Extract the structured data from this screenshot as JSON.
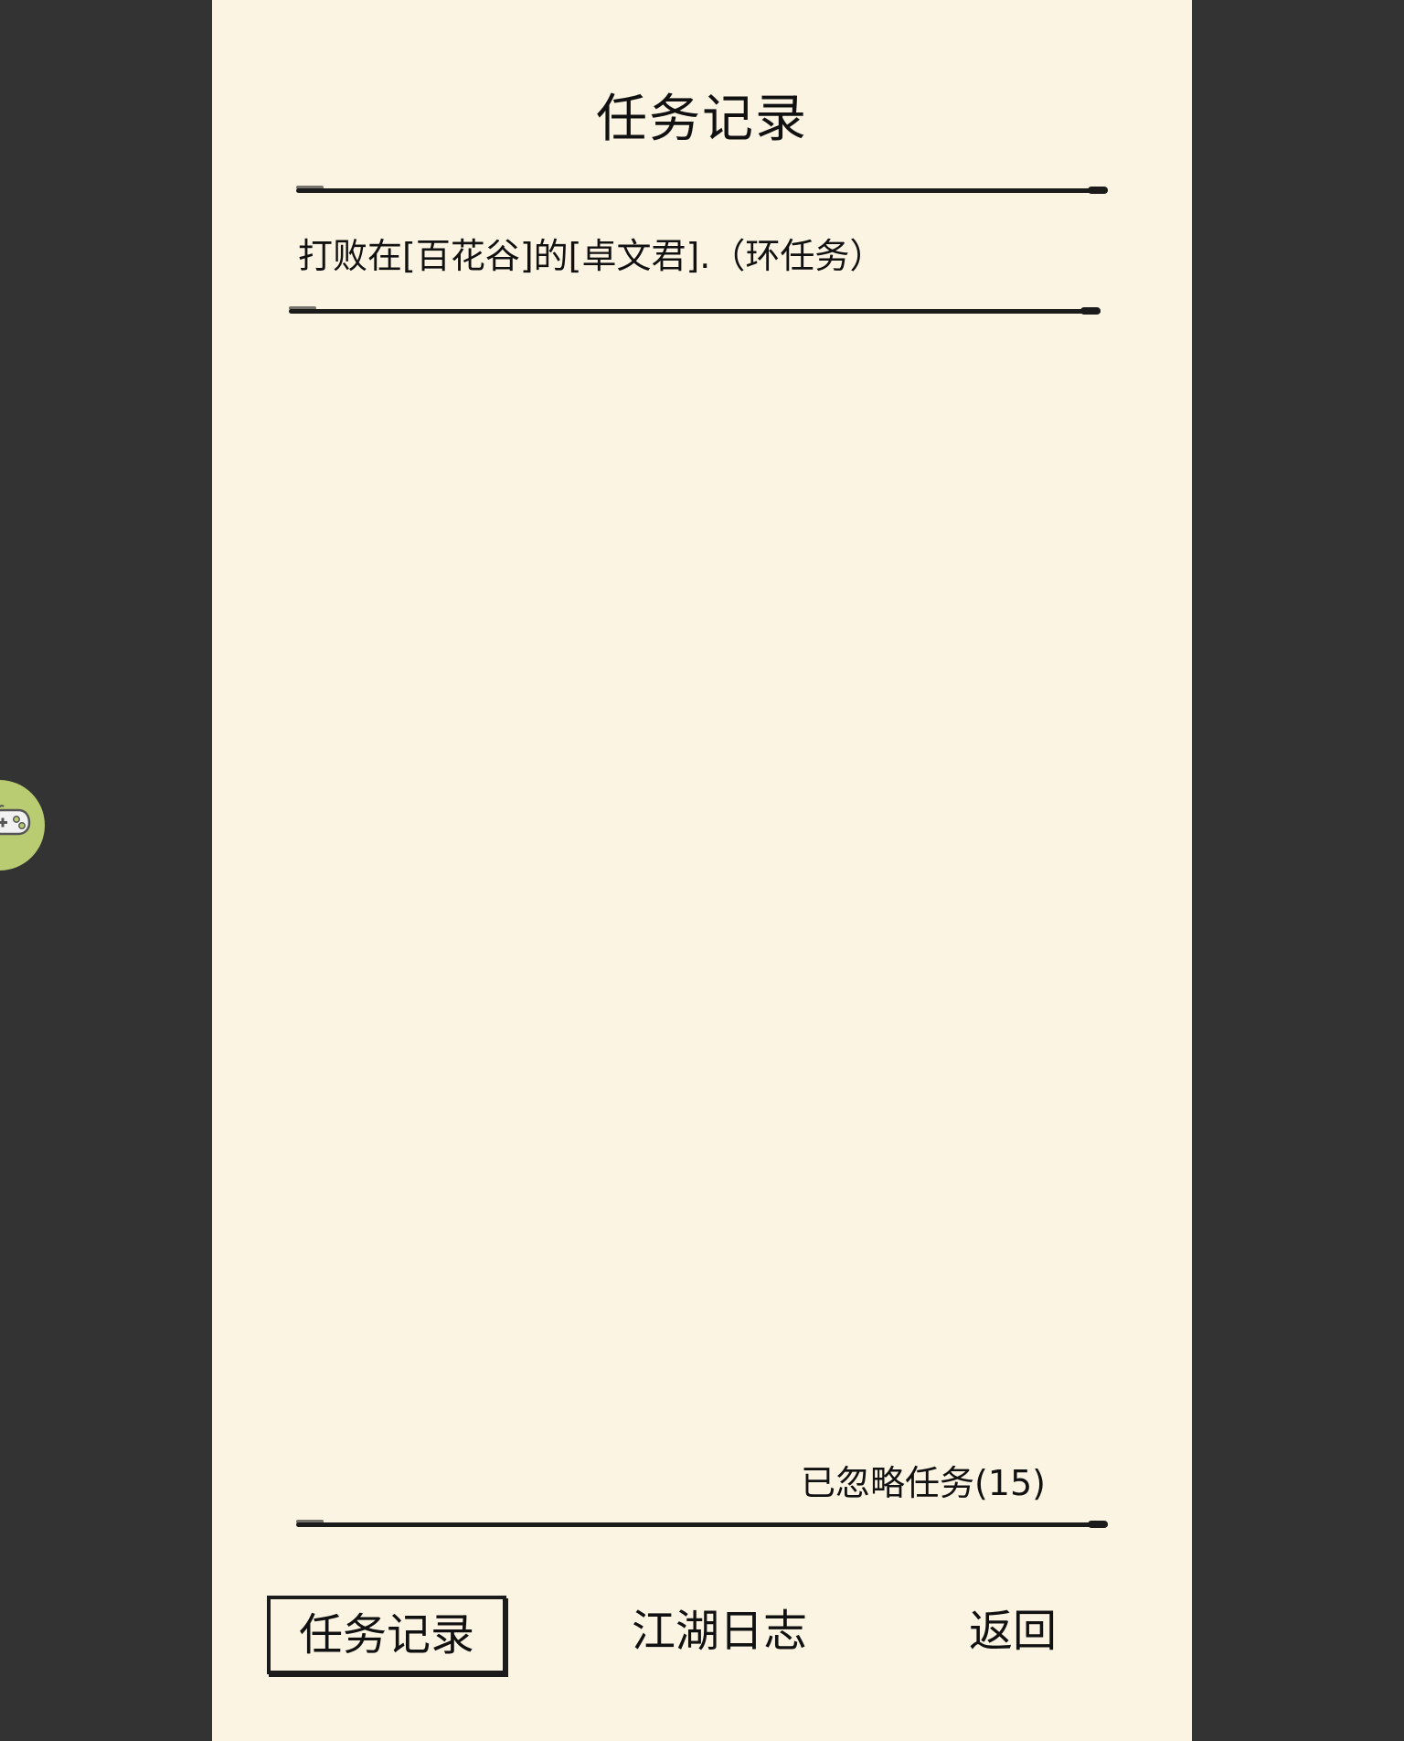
{
  "header": {
    "title": "任务记录"
  },
  "tasks": [
    {
      "text": "打败在[百花谷]的[卓文君].（环任务）"
    }
  ],
  "ignored": {
    "label": "已忽略任务(15)"
  },
  "nav": {
    "quest_log": "任务记录",
    "jianghu_log": "江湖日志",
    "back": "返回"
  },
  "floating": {
    "icon": "gamepad-icon",
    "bg_color": "#b9cc72"
  },
  "colors": {
    "panel_bg": "#fbf4e3",
    "side_bg": "#333333",
    "ink": "#1b1b1b"
  }
}
